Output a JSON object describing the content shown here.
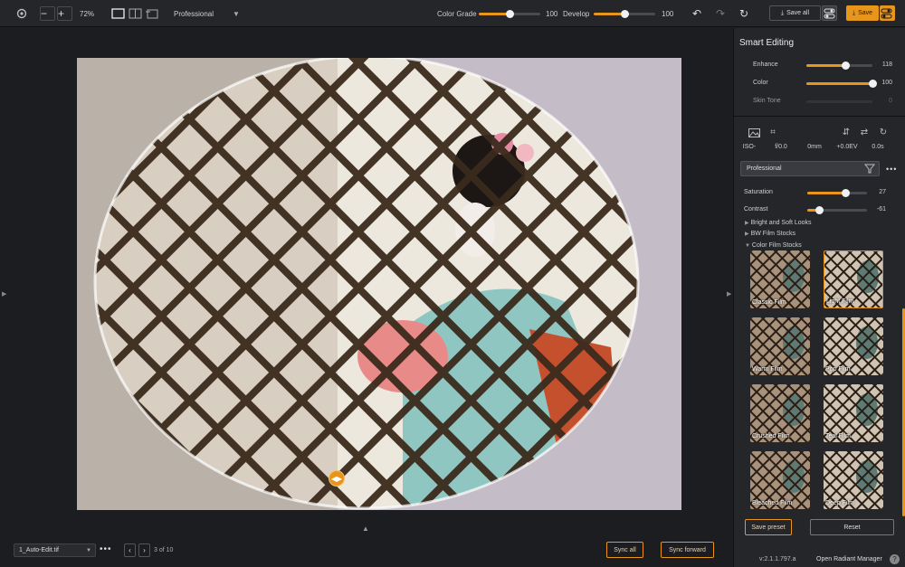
{
  "toolbar": {
    "zoom": "72%",
    "preset": "Professional",
    "color_grade_label": "Color Grade",
    "color_grade_value": "100",
    "color_grade_level": 1.0,
    "develop_label": "Develop",
    "develop_value": "100",
    "develop_level": 1.0,
    "save_all_label": "Save all",
    "save_label": "Save"
  },
  "bottom": {
    "file_name": "1_Auto-Edit.tif",
    "page_counter": "3 of 10",
    "sync_all_label": "Sync all",
    "sync_forward_label": "Sync forward"
  },
  "panel": {
    "title": "Smart Editing",
    "rows": [
      {
        "label": "Enhance",
        "value": "118",
        "level": 0.59
      },
      {
        "label": "Color",
        "value": "100",
        "level": 1.0
      },
      {
        "label": "Skin Tone",
        "value": "0",
        "level": 0.0
      }
    ],
    "exif": {
      "iso": "ISO-",
      "aperture": "f/0.0",
      "focal": "0mm",
      "ev": "+0.0EV",
      "shutter": "0.0s"
    },
    "preset_select": "Professional",
    "saturation": {
      "label": "Saturation",
      "value": "27",
      "level": 0.635
    },
    "contrast": {
      "label": "Contrast",
      "value": "-61",
      "level": 0.195
    },
    "tree": [
      {
        "label": "Bright and Soft Looks",
        "expanded": false
      },
      {
        "label": "BW Film Stocks",
        "expanded": false
      },
      {
        "label": "Color Film Stocks",
        "expanded": true
      }
    ],
    "thumbnails": [
      {
        "label": "Classic Film",
        "selected": false
      },
      {
        "label": "Light Film",
        "selected": true
      },
      {
        "label": "Warm Film",
        "selected": false
      },
      {
        "label": "Pop Film",
        "selected": false
      },
      {
        "label": "Crushed Film",
        "selected": false
      },
      {
        "label": "Teal Film",
        "selected": false
      },
      {
        "label": "Bleached Film",
        "selected": false
      },
      {
        "label": "Deep Film",
        "selected": false
      }
    ],
    "save_preset_label": "Save preset",
    "reset_label": "Reset",
    "version": "v:2.1.1.797.a",
    "manager_link": "Open Radiant Manager",
    "help": "?"
  },
  "colors": {
    "accent": "#e8951c",
    "panel_bg": "#25262a",
    "canvas_bg": "#1c1d20"
  }
}
